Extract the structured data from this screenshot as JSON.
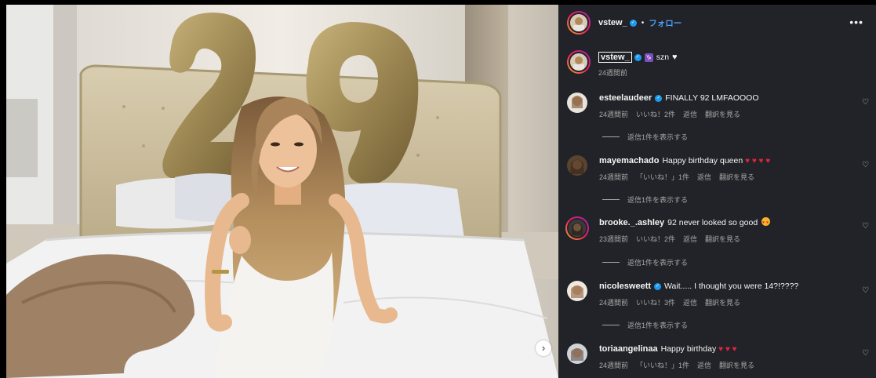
{
  "post": {
    "username": "vstew_",
    "separator": "•",
    "follow_label": "フォロー",
    "more_icon": "more-horizontal-icon",
    "caption": {
      "username": "vstew_",
      "sign": "♑",
      "text": "szn",
      "heart": "♥",
      "time": "24週間前"
    },
    "next_icon": "chevron-right-icon"
  },
  "comments": [
    {
      "username": "esteelaudeer",
      "verified": true,
      "text": "FINALLY 92 LMFAOOOO",
      "time": "24週間前",
      "likes": "いいね！2件",
      "reply": "返信",
      "translate": "翻訳を見る",
      "view_replies": "返信1件を表示する"
    },
    {
      "username": "mayemachado",
      "verified": false,
      "text": "Happy birthday queen",
      "hearts": "♥ ♥ ♥ ♥",
      "time": "24週間前",
      "likes": "「いいね！」1件",
      "reply": "返信",
      "translate": "翻訳を見る",
      "view_replies": "返信1件を表示する"
    },
    {
      "username": "brooke._.ashley",
      "verified": false,
      "text": "92 never looked so good",
      "time": "23週間前",
      "likes": "いいね！2件",
      "reply": "返信",
      "translate": "翻訳を見る",
      "view_replies": "返信1件を表示する"
    },
    {
      "username": "nicolesweett",
      "verified": true,
      "text": "Wait..... I thought you were 14?!????",
      "time": "24週間前",
      "likes": "いいね！3件",
      "reply": "返信",
      "translate": "翻訳を見る",
      "view_replies": "返信1件を表示する"
    },
    {
      "username": "toriaangelinaa",
      "verified": false,
      "text": "Happy birthday",
      "hearts": "♥ ♥ ♥",
      "time": "24週間前",
      "likes": "「いいね！」1件",
      "reply": "返信",
      "translate": "翻訳を見る"
    }
  ],
  "icons": {
    "like": "heart-outline-icon",
    "verified": "verified-badge-icon"
  },
  "colors": {
    "panel_bg": "#212328",
    "accent_blue": "#4f9ff5",
    "verified_blue": "#1d9bf0",
    "heart_red": "#e0243c",
    "muted_text": "#a8a8a8"
  }
}
